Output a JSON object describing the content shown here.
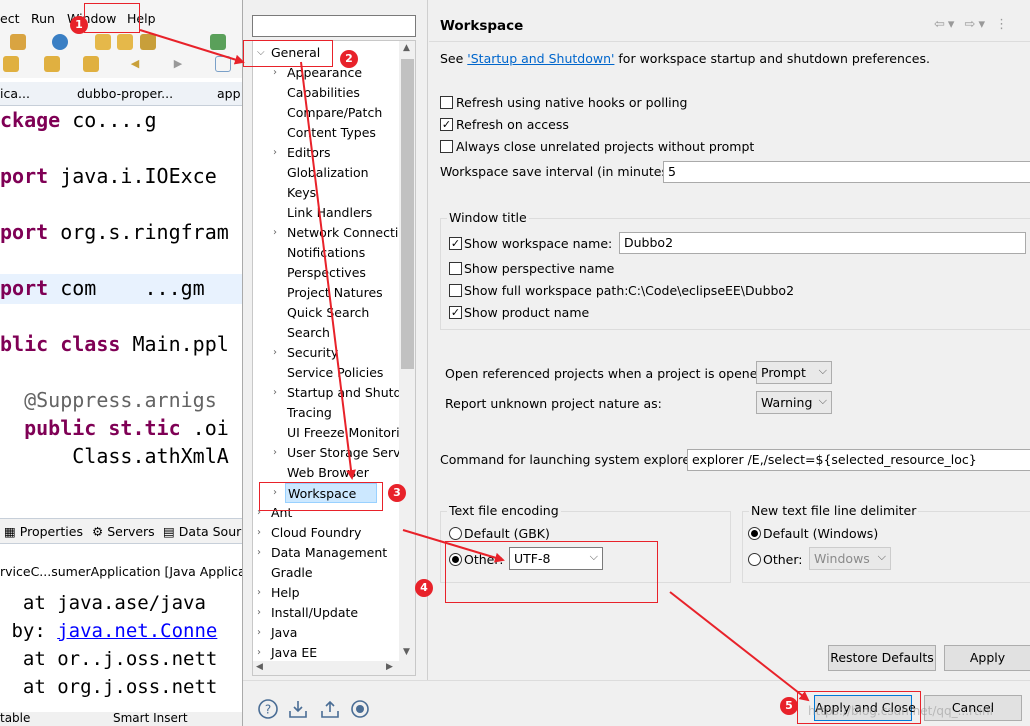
{
  "ide": {
    "menu": {
      "partial": "ect",
      "run": "Run",
      "window": "Window",
      "help": "Help"
    },
    "editor_tabs": [
      "ica...",
      "dubbo-proper...",
      "app"
    ],
    "code_lines": [
      {
        "pre": "",
        "kw": "ckage",
        "post": " co....g"
      },
      {
        "pre": "",
        "kw": "port",
        "post": " java.i.IOExce"
      },
      {
        "pre": "",
        "kw": "port",
        "post": " org.s.ringfram"
      },
      {
        "pre": "",
        "kw": "port",
        "post": " com    ...gm"
      },
      {
        "pre": "",
        "kw": "blic class",
        "post": " Main.ppl"
      },
      {
        "pre": "  ",
        "ann": "@Suppress.arnigs",
        "post": ""
      },
      {
        "pre": "  ",
        "kw": "public st.tic",
        "post": " .oi"
      },
      {
        "pre": "      ",
        "kw": "",
        "post": "Class.athXmlA"
      }
    ],
    "bottom_tabs": [
      "Properties",
      "Servers",
      "Data Sour"
    ],
    "console": {
      "title": "rviceC...sumerApplication [Java Application",
      "lines": [
        "  at java.ase/java",
        " by: ",
        "  at or..j.oss.nett",
        "  at org.j.oss.nett"
      ],
      "link": "java.net.Conne"
    },
    "status": {
      "left": "table",
      "right": "Smart Insert"
    }
  },
  "dialog": {
    "filter_placeholder": "",
    "tree": [
      {
        "label": "General",
        "level": 0,
        "expanded": true,
        "twisty": true
      },
      {
        "label": "Appearance",
        "level": 1,
        "twisty": true
      },
      {
        "label": "Capabilities",
        "level": 1
      },
      {
        "label": "Compare/Patch",
        "level": 1
      },
      {
        "label": "Content Types",
        "level": 1
      },
      {
        "label": "Editors",
        "level": 1,
        "twisty": true
      },
      {
        "label": "Globalization",
        "level": 1
      },
      {
        "label": "Keys",
        "level": 1
      },
      {
        "label": "Link Handlers",
        "level": 1
      },
      {
        "label": "Network Connectio",
        "level": 1,
        "twisty": true
      },
      {
        "label": "Notifications",
        "level": 1
      },
      {
        "label": "Perspectives",
        "level": 1
      },
      {
        "label": "Project Natures",
        "level": 1
      },
      {
        "label": "Quick Search",
        "level": 1
      },
      {
        "label": "Search",
        "level": 1
      },
      {
        "label": "Security",
        "level": 1,
        "twisty": true
      },
      {
        "label": "Service Policies",
        "level": 1
      },
      {
        "label": "Startup and Shutdo",
        "level": 1,
        "twisty": true
      },
      {
        "label": "Tracing",
        "level": 1
      },
      {
        "label": "UI Freeze Monitorin",
        "level": 1
      },
      {
        "label": "User Storage Servic",
        "level": 1,
        "twisty": true
      },
      {
        "label": "Web Browser",
        "level": 1
      },
      {
        "label": "Workspace",
        "level": 1,
        "twisty": true,
        "selected": true
      },
      {
        "label": "Ant",
        "level": 0,
        "twisty": true
      },
      {
        "label": "Cloud Foundry",
        "level": 0,
        "twisty": true
      },
      {
        "label": "Data Management",
        "level": 0,
        "twisty": true
      },
      {
        "label": "Gradle",
        "level": 0
      },
      {
        "label": "Help",
        "level": 0,
        "twisty": true
      },
      {
        "label": "Install/Update",
        "level": 0,
        "twisty": true
      },
      {
        "label": "Java",
        "level": 0,
        "twisty": true
      },
      {
        "label": "Java EE",
        "level": 0,
        "twisty": true
      }
    ],
    "page": {
      "title": "Workspace",
      "intro_before": "See ",
      "intro_link": "'Startup and Shutdown'",
      "intro_after": " for workspace startup and shutdown preferences.",
      "refresh_native": "Refresh using native hooks or polling",
      "refresh_access": "Refresh on access",
      "always_close": "Always close unrelated projects without prompt",
      "save_interval_label": "Workspace save interval (in minutes):",
      "save_interval_value": "5",
      "window_title_group": "Window title",
      "show_ws_name": "Show workspace name:",
      "ws_name_value": "Dubbo2",
      "show_perspective": "Show perspective name",
      "show_full_path": "Show full workspace path:",
      "full_path_value": "C:\\Code\\eclipseEE\\Dubbo2",
      "show_product": "Show product name",
      "open_ref_label": "Open referenced projects when a project is opened:",
      "open_ref_value": "Prompt",
      "report_unknown_label": "Report unknown project nature as:",
      "report_unknown_value": "Warning",
      "cmd_label": "Command for launching system explorer:",
      "cmd_value": "explorer /E,/select=${selected_resource_loc}",
      "encoding_group": "Text file encoding",
      "enc_default": "Default (GBK)",
      "enc_other": "Other:",
      "enc_other_value": "UTF-8",
      "delim_group": "New text file line delimiter",
      "delim_default": "Default (Windows)",
      "delim_other": "Other:",
      "delim_other_value": "Windows",
      "restore_defaults": "Restore Defaults",
      "apply": "Apply"
    },
    "footer": {
      "apply_close": "Apply and Close",
      "cancel": "Cancel"
    }
  },
  "annotations": {
    "badges": [
      "1",
      "2",
      "3",
      "4",
      "5"
    ],
    "color": "#e8222a"
  },
  "watermark": "https://blog.csdn.net/qq_...rtini"
}
